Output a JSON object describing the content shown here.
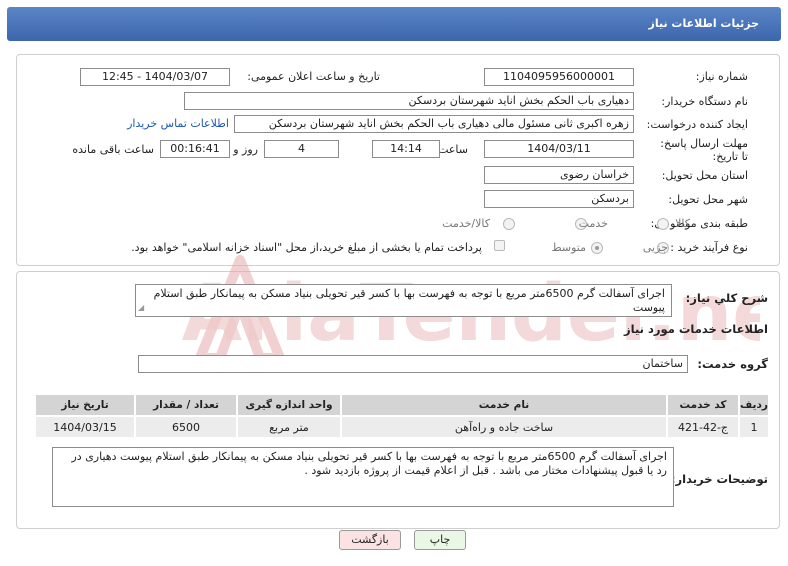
{
  "header": {
    "title": "جزئیات اطلاعات نیاز"
  },
  "form": {
    "need_number": {
      "label": "شماره نیاز:",
      "value": "1104095956000001"
    },
    "announce_datetime": {
      "label": "تاریخ و ساعت اعلان عمومی:",
      "value": "1404/03/07 - 12:45"
    },
    "buyer_org": {
      "label": "نام دستگاه خریدار:",
      "value": "دهیاری باب الحکم بخش اناید شهرستان بردسکن"
    },
    "requester": {
      "label": "ایجاد کننده درخواست:",
      "value": "زهره اکبری ثانی مسئول مالی دهیاری باب الحکم بخش اناید شهرستان بردسکن",
      "contact_link": "اطلاعات تماس خریدار"
    },
    "deadline": {
      "label": "مهلت ارسال پاسخ: تا تاریخ:",
      "date": "1404/03/11",
      "time_label": "ساعت",
      "time": "14:14",
      "days": "4",
      "days_label": "روز و",
      "remaining": "00:16:41",
      "remaining_label": "ساعت باقی مانده"
    },
    "province": {
      "label": "استان محل تحویل:",
      "value": "خراسان رضوی"
    },
    "city": {
      "label": "شهر محل تحویل:",
      "value": "بردسکن"
    },
    "category": {
      "label": "طبقه بندی موضوعی:",
      "options": [
        "کالا",
        "خدمت",
        "کالا/خدمت"
      ]
    },
    "process": {
      "label": "نوع فرآیند خرید :",
      "options": [
        "جزیی",
        "متوسط"
      ],
      "payment_note": "پرداخت تمام یا بخشی از مبلغ خرید،از محل \"اسناد خزانه اسلامی\" خواهد بود."
    }
  },
  "description": {
    "label": "شرح کلي نياز:",
    "text": "اجرای آسفالت گرم 6500متر مربع با توجه به فهرست بها با کسر قیر تحویلی بنیاد مسکن به پیمانکار طبق استلام پیوست"
  },
  "services": {
    "section_title": "اطلاعات خدمات مورد نياز",
    "group_label": "گروه خدمت:",
    "group_value": "ساختمان",
    "columns": [
      "ردیف",
      "کد خدمت",
      "نام خدمت",
      "واحد اندازه گیری",
      "تعداد / مقدار",
      "تاریخ نیاز"
    ],
    "rows": [
      [
        "1",
        "ج-42-421",
        "ساخت جاده و راه‌آهن",
        "متر مربع",
        "6500",
        "1404/03/15"
      ]
    ]
  },
  "buyer_notes": {
    "label": "توضیحات خریدار:",
    "text": "اجرای آسفالت گرم 6500متر مربع با توجه به فهرست بها با کسر قیر تحویلی بنیاد مسکن به پیمانکار طبق استلام پیوست دهیاری در رد یا قبول پیشنهادات مختار می باشد . قبل از اعلام قیمت از پروژه بازدید شود ."
  },
  "buttons": {
    "print": "چاپ",
    "back": "بازگشت"
  },
  "watermark_text": "AriaTender.neT",
  "colors": {
    "header": "#4a76bb",
    "link": "#1d56b8",
    "print_btn": "#e9f7e4",
    "back_btn": "#fbe3e3",
    "watermark": "#e8b8b8"
  }
}
